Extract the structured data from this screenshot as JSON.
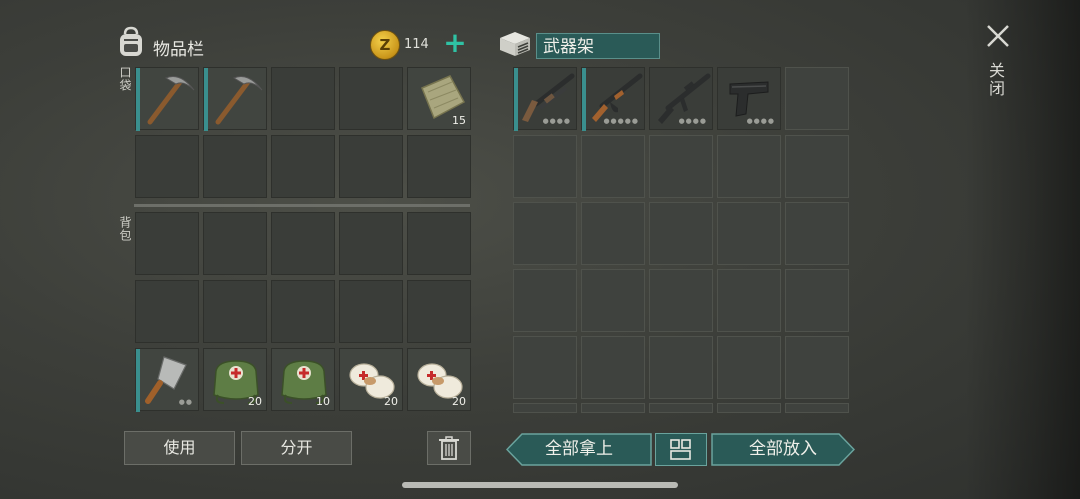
{
  "inventory": {
    "title": "物品栏",
    "coins": "114",
    "add_coins_symbol": "+",
    "pocket_label": "口袋",
    "backpack_label": "背包",
    "items": [
      {
        "name": "pickaxe",
        "count": "",
        "durability": ""
      },
      {
        "name": "pickaxe",
        "count": "",
        "durability": ""
      },
      {
        "name": "cloth",
        "count": "15",
        "durability": ""
      },
      {
        "name": "cleaver",
        "count": "",
        "durability": "●●"
      },
      {
        "name": "first-aid-kit",
        "count": "20",
        "durability": ""
      },
      {
        "name": "first-aid-kit",
        "count": "10",
        "durability": ""
      },
      {
        "name": "bandage",
        "count": "20",
        "durability": ""
      },
      {
        "name": "bandage",
        "count": "20",
        "durability": ""
      }
    ]
  },
  "rack": {
    "title": "武器架",
    "items": [
      {
        "name": "shotgun",
        "durability": "●●●●"
      },
      {
        "name": "ak-rifle",
        "durability": "●●●●●"
      },
      {
        "name": "m16-rifle",
        "durability": "●●●●"
      },
      {
        "name": "pistol",
        "durability": "●●●●"
      }
    ]
  },
  "close": {
    "symbol": "✕",
    "label": "关闭"
  },
  "buttons": {
    "use": "使用",
    "split": "分开",
    "take_all": "全部拿上",
    "put_all": "全部放入"
  },
  "colors": {
    "accent": "#3a8f8e",
    "plus": "#2fc2a4",
    "coin": "#e0b22e"
  }
}
